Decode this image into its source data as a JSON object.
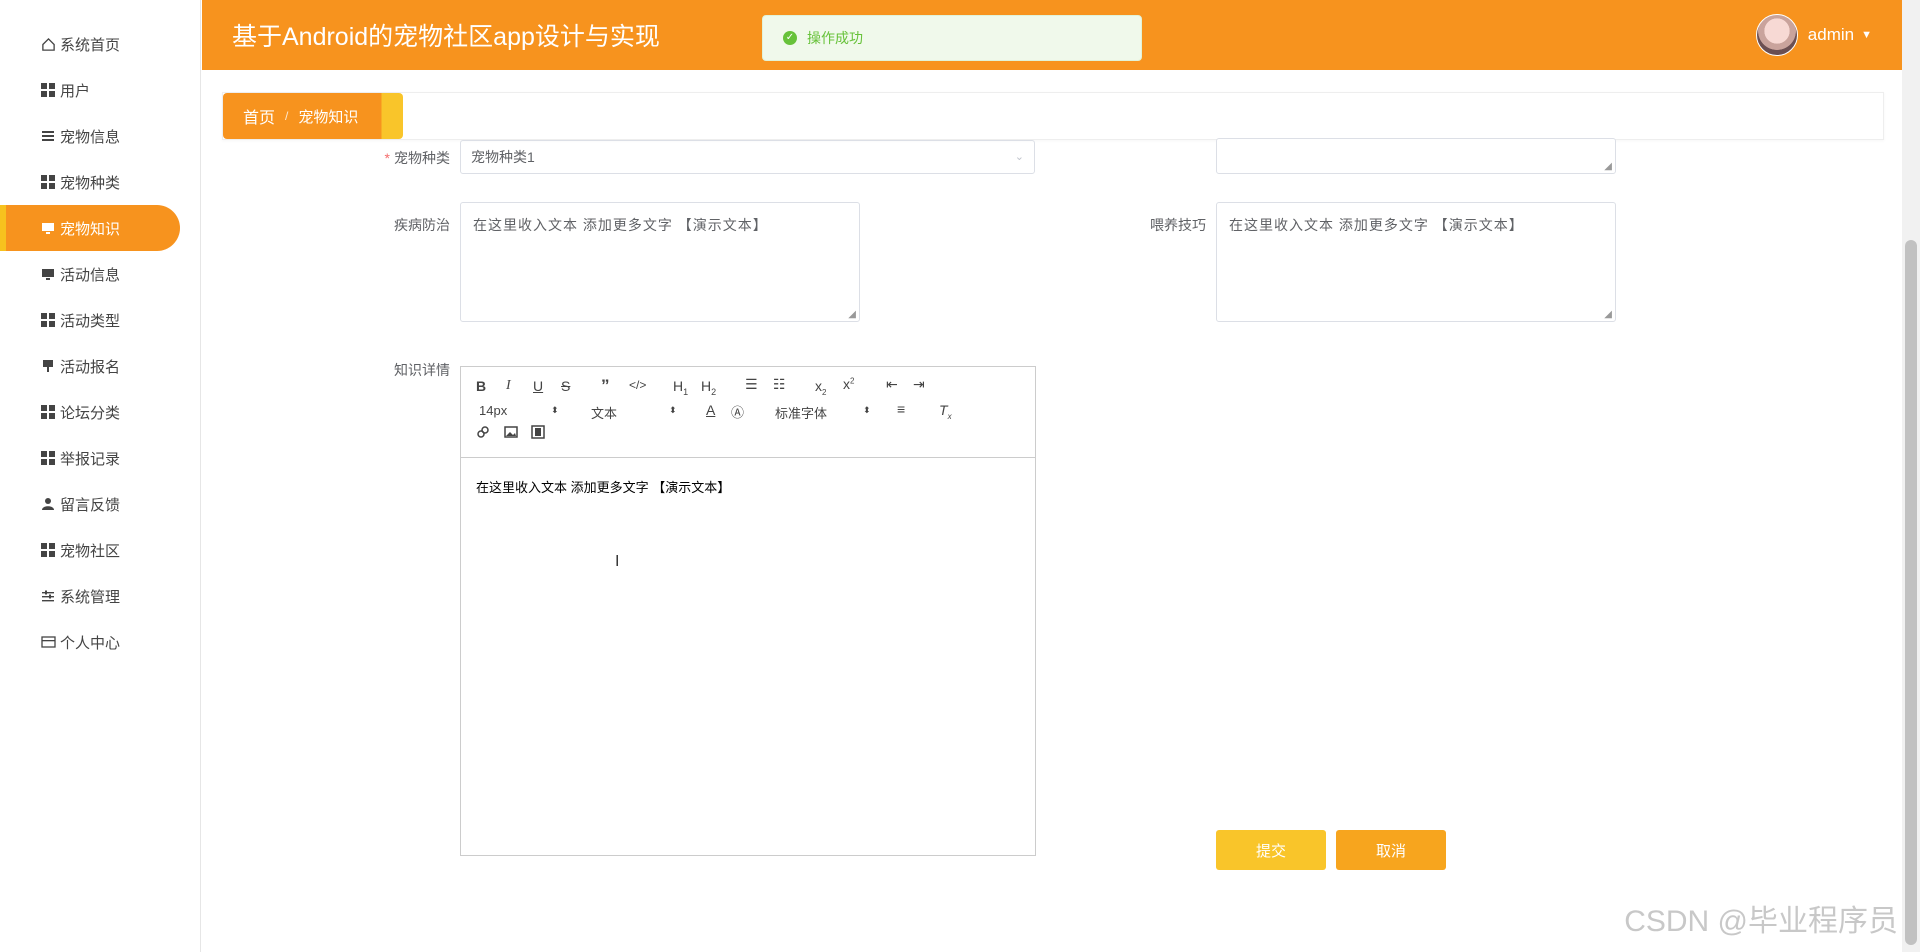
{
  "app": {
    "title": "基于Android的宠物社区app设计与实现"
  },
  "toast": {
    "text": "操作成功"
  },
  "user": {
    "name": "admin"
  },
  "sidebar": {
    "items": [
      {
        "label": "系统首页",
        "icon": "home-icon"
      },
      {
        "label": "用户",
        "icon": "grid-icon"
      },
      {
        "label": "宠物信息",
        "icon": "list-icon"
      },
      {
        "label": "宠物种类",
        "icon": "grid-icon"
      },
      {
        "label": "宠物知识",
        "icon": "monitor-icon",
        "active": true
      },
      {
        "label": "活动信息",
        "icon": "monitor-icon"
      },
      {
        "label": "活动类型",
        "icon": "grid-icon"
      },
      {
        "label": "活动报名",
        "icon": "pin-icon"
      },
      {
        "label": "论坛分类",
        "icon": "grid-icon"
      },
      {
        "label": "举报记录",
        "icon": "grid-icon"
      },
      {
        "label": "留言反馈",
        "icon": "user-icon"
      },
      {
        "label": "宠物社区",
        "icon": "grid-icon"
      },
      {
        "label": "系统管理",
        "icon": "sliders-icon"
      },
      {
        "label": "个人中心",
        "icon": "card-icon"
      }
    ]
  },
  "breadcrumb": {
    "home": "首页",
    "current": "宠物知识"
  },
  "form": {
    "pet_type": {
      "label": "宠物种类",
      "value": "宠物种类1"
    },
    "disease": {
      "label": "疾病防治",
      "value": "在这里收入文本 添加更多文字 【演示文本】"
    },
    "feeding": {
      "label": "喂养技巧",
      "value": "在这里收入文本 添加更多文字 【演示文本】"
    },
    "detail": {
      "label": "知识详情"
    }
  },
  "editor": {
    "font_size": "14px",
    "block_type": "文本",
    "font_family": "标准字体",
    "content": "在这里收入文本 添加更多文字 【演示文本】"
  },
  "buttons": {
    "submit": "提交",
    "cancel": "取消"
  },
  "watermark": "CSDN @毕业程序员",
  "colors": {
    "accent": "#f7931e",
    "accent_light": "#f9c52a",
    "success": "#67c23a"
  }
}
